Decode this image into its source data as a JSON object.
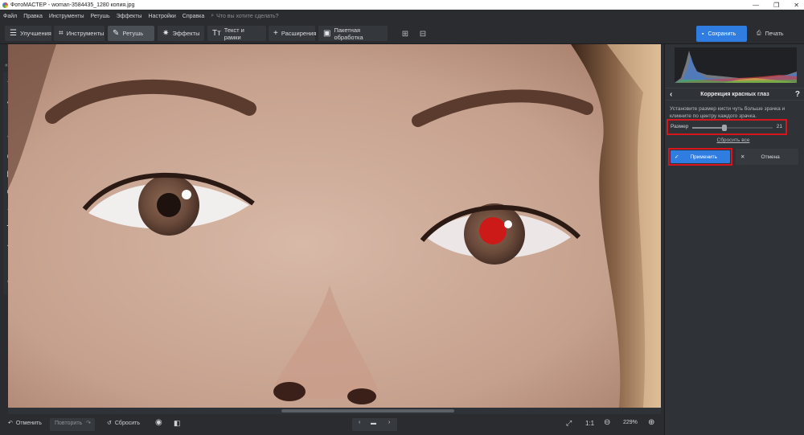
{
  "window": {
    "title": "ФотоМАСТЕР - woman-3584435_1280 копия.jpg",
    "minimize": "—",
    "maximize": "❐",
    "close": "✕"
  },
  "menu": {
    "items": [
      "Файл",
      "Правка",
      "Инструменты",
      "Ретушь",
      "Эффекты",
      "Настройки",
      "Справка"
    ],
    "search_placeholder": "Что вы хотите сделать?"
  },
  "toolbar": {
    "tabs": [
      {
        "label": "Улучшения",
        "icon": "sliders-icon"
      },
      {
        "label": "Инструменты",
        "icon": "crop-icon"
      },
      {
        "label": "Ретушь",
        "icon": "brush-icon",
        "active": true
      },
      {
        "label": "Эффекты",
        "icon": "sparkle-icon"
      },
      {
        "label": "Текст и рамки",
        "icon": "text-icon"
      },
      {
        "label": "Расширения",
        "icon": "plus-icon"
      },
      {
        "label": "Пакетная обработка",
        "icon": "batch-icon"
      }
    ],
    "save_label": "Сохранить",
    "print_label": "Печать"
  },
  "left_tools": [
    "fix-icon",
    "patch-icon",
    "stamp-icon",
    "brush-icon",
    "radial-icon",
    "gradient-icon",
    "frame-icon",
    "sun-icon",
    "text-icon",
    "fill-icon",
    "magnet-icon",
    "globe-icon"
  ],
  "panel": {
    "title": "Коррекция красных глаз",
    "hint": "Установите размер кисти чуть больше зрачка и кликните по центру каждого зрачка.",
    "size_label": "Размер",
    "size_value": "21",
    "size_fraction": 0.4,
    "reset_all": "Сбросить все",
    "apply": "Применить",
    "cancel": "Отмена"
  },
  "bottom": {
    "undo": "Отменить",
    "redo": "Повторить",
    "reset": "Сбросить",
    "fit": "1:1",
    "zoom": "229%"
  },
  "colors": {
    "accent": "#2f7de1",
    "highlight": "#d8141c",
    "red_eye": "#cc1a18"
  }
}
